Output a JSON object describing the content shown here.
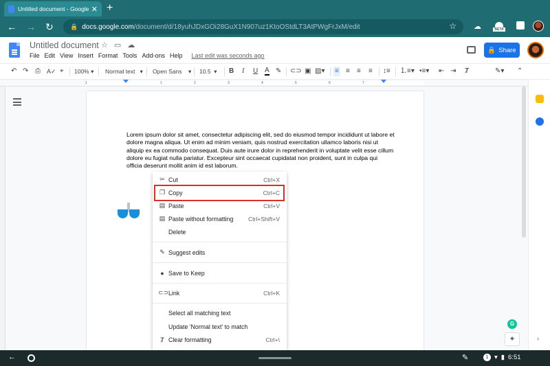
{
  "browser": {
    "tab_title": "Untitled document - Google Do",
    "url_host": "docs.google.com",
    "url_path": "/document/d/18yuhJDxGOi28GuX1N907uz1KtoOStdLT3AtPWgFrJxM/edit",
    "extension_badge": "BETA"
  },
  "docs": {
    "title": "Untitled document",
    "menu": [
      "File",
      "Edit",
      "View",
      "Insert",
      "Format",
      "Tools",
      "Add-ons",
      "Help"
    ],
    "last_edit": "Last edit was seconds ago",
    "share_label": "Share"
  },
  "toolbar": {
    "zoom": "100%",
    "style": "Normal text",
    "font": "Open Sans",
    "font_size": "10.5",
    "bold": "B",
    "italic": "I",
    "underline": "U",
    "text_color": "A"
  },
  "ruler_ticks": [
    "1",
    "1",
    "2",
    "3",
    "4",
    "5",
    "6",
    "7"
  ],
  "document_text": "Lorem ipsum dolor sit amet, consectetur adipiscing elit, sed do eiusmod tempor incididunt ut labore et dolore magna aliqua. Ut enim ad minim veniam, quis nostrud exercitation ullamco laboris nisi ut aliquip ex ea commodo consequat. Duis aute irure dolor in reprehenderit in voluptate velit esse cillum dolore eu fugiat nulla pariatur. Excepteur sint occaecat cupidatat non proident, sunt in culpa qui officia deserunt mollit anim id est laborum.",
  "context_menu": {
    "cut": {
      "label": "Cut",
      "shortcut": "Ctrl+X",
      "icon": "scissors-icon"
    },
    "copy": {
      "label": "Copy",
      "shortcut": "Ctrl+C",
      "icon": "copy-icon"
    },
    "paste": {
      "label": "Paste",
      "shortcut": "Ctrl+V",
      "icon": "paste-icon"
    },
    "paste_plain": {
      "label": "Paste without formatting",
      "shortcut": "Ctrl+Shift+V",
      "icon": "paste-plain-icon"
    },
    "delete": {
      "label": "Delete"
    },
    "suggest": {
      "label": "Suggest edits",
      "icon": "suggest-icon"
    },
    "keep": {
      "label": "Save to Keep",
      "icon": "keep-bulb-icon"
    },
    "link": {
      "label": "Link",
      "shortcut": "Ctrl+K",
      "icon": "link-icon"
    },
    "select_matching": {
      "label": "Select all matching text"
    },
    "update_style": {
      "label": "Update 'Normal text' to match"
    },
    "clear_format": {
      "label": "Clear formatting",
      "shortcut": "Ctrl+\\",
      "icon": "clear-format-icon"
    }
  },
  "highlight_color": "#d93025",
  "accent_color": "#1a73e8",
  "shelf": {
    "time": "6:51",
    "notification_count": "1"
  }
}
